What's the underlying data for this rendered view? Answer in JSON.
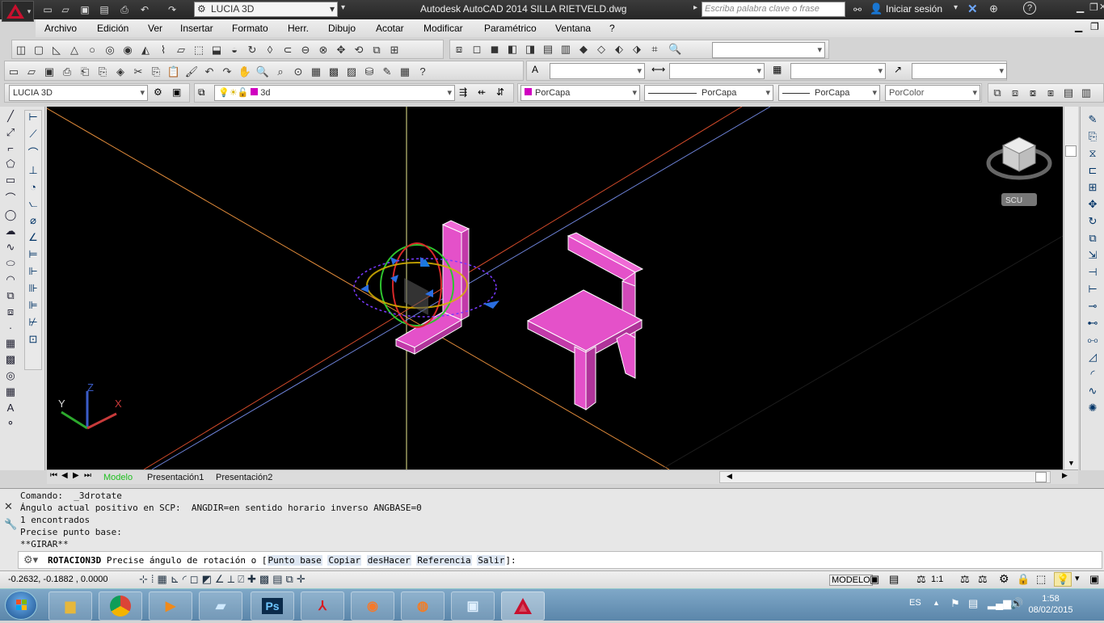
{
  "titlebar": {
    "workspace": "LUCIA 3D",
    "title": "Autodesk AutoCAD 2014    SILLA RIETVELD.dwg",
    "search_placeholder": "Escriba palabra clave o frase",
    "login": "Iniciar sesión",
    "help": "?"
  },
  "menu": [
    "Archivo",
    "Edición",
    "Ver",
    "Insertar",
    "Formato",
    "Herr.",
    "Dibujo",
    "Acotar",
    "Modificar",
    "Paramétrico",
    "Ventana",
    "?"
  ],
  "toolbar3": {
    "view_combo": "LUCIA 3D",
    "layer_combo": "3d",
    "color_combo": "PorCapa",
    "linetype_combo": "PorCapa",
    "lineweight_combo": "PorCapa",
    "plotstyle_combo": "PorColor"
  },
  "viewcube": {
    "label": "SCU"
  },
  "ucs": {
    "x": "X",
    "y": "Y",
    "z": "Z"
  },
  "tabs": [
    "Modelo",
    "Presentación1",
    "Presentación2"
  ],
  "command_history": [
    "Comando:  _3drotate",
    "Ángulo actual positivo en SCP:  ANGDIR=en sentido horario inverso ANGBASE=0",
    "1 encontrados",
    "Precise punto base:",
    "**GIRAR**"
  ],
  "command_prompt": {
    "name": "ROTACION3D",
    "text": "Precise ángulo de rotación o [",
    "options": [
      "Punto base",
      "Copiar",
      "desHacer",
      "Referencia",
      "Salir"
    ],
    "end": "]:"
  },
  "status": {
    "coords": "-0.2632,  -0.1882 , 0.0000",
    "model": "MODELO",
    "scale": "1:1"
  },
  "taskbar": {
    "lang": "ES",
    "time": "1:58",
    "date": "08/02/2015"
  },
  "colors": {
    "viewport_bg": "#000000",
    "object": "#e451c9",
    "titlebar": "#2f2f2f",
    "active_tab": "#2fd42f"
  }
}
